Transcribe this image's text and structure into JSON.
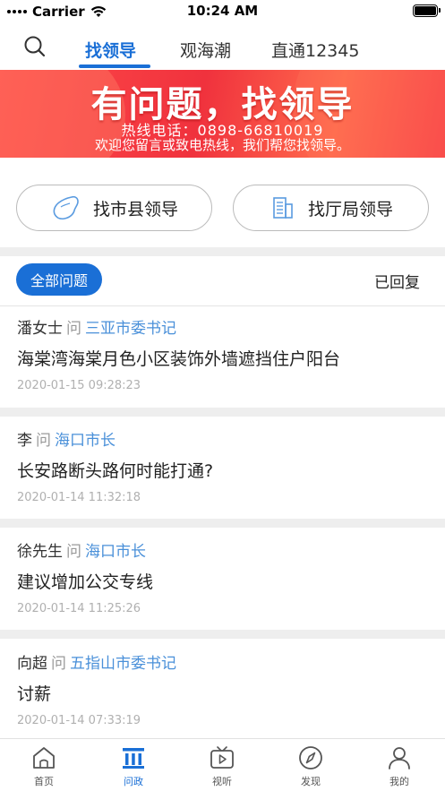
{
  "status_bar": {
    "carrier": "Carrier",
    "time": "10:24 AM"
  },
  "top_tabs": [
    {
      "label": "找领导",
      "active": true
    },
    {
      "label": "观海潮",
      "active": false
    },
    {
      "label": "直通12345",
      "active": false
    }
  ],
  "banner": {
    "title": "有问题，找领导",
    "hotline": "热线电话：0898-66810019",
    "subtitle": "欢迎您留言或致电热线，我们帮您找领导。"
  },
  "finders": {
    "county": "找市县领导",
    "bureau": "找厅局领导"
  },
  "filters": {
    "all": "全部问题",
    "replied": "已回复"
  },
  "ask_word": "问",
  "questions": [
    {
      "name": "潘女士",
      "target": "三亚市委书记",
      "title": "海棠湾海棠月色小区装饰外墙遮挡住户阳台",
      "time": "2020-01-15 09:28:23"
    },
    {
      "name": "李",
      "target": "海口市长",
      "title": "长安路断头路何时能打通?",
      "time": "2020-01-14 11:32:18"
    },
    {
      "name": "徐先生",
      "target": "海口市长",
      "title": "建议增加公交专线",
      "time": "2020-01-14 11:25:26"
    },
    {
      "name": "向超",
      "target": "五指山市委书记",
      "title": "讨薪",
      "time": "2020-01-14 07:33:19"
    }
  ],
  "bottom_tabs": [
    {
      "label": "首页",
      "icon": "home-icon",
      "active": false
    },
    {
      "label": "问政",
      "icon": "government-pillars-icon",
      "active": true
    },
    {
      "label": "视听",
      "icon": "tv-play-icon",
      "active": false
    },
    {
      "label": "发现",
      "icon": "compass-icon",
      "active": false
    },
    {
      "label": "我的",
      "icon": "user-icon",
      "active": false
    }
  ],
  "colors": {
    "accent": "#1a6fd6",
    "link": "#4a90d9",
    "banner": "#f0323d"
  }
}
